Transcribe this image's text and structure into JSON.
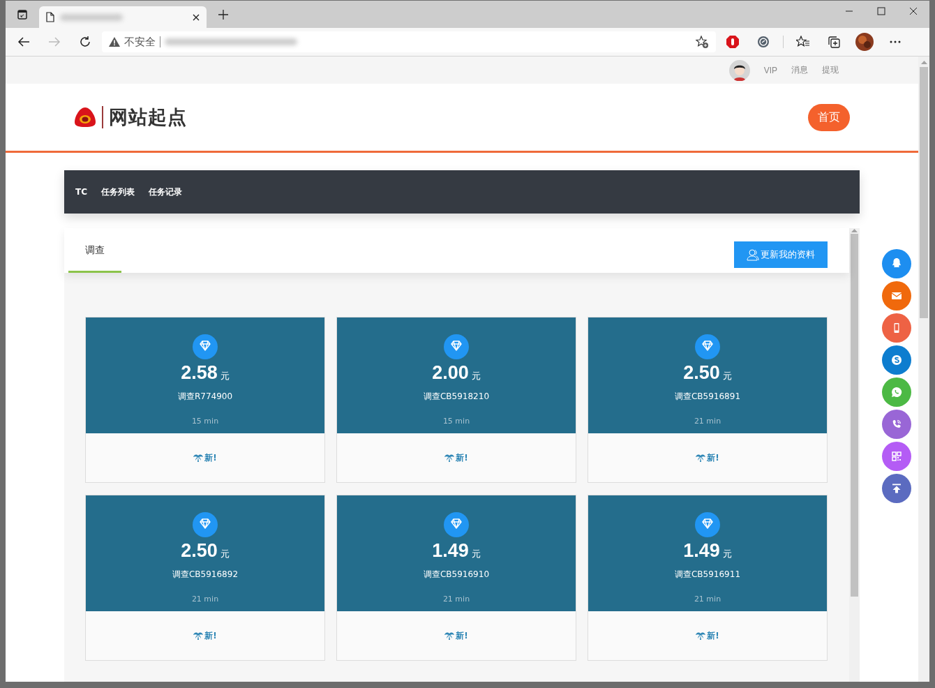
{
  "browser": {
    "security_label": "不安全"
  },
  "topbar": {
    "links": [
      "VIP",
      "消息",
      "提现"
    ]
  },
  "header": {
    "logo_text": "网站起点",
    "home_button": "首页"
  },
  "nav": {
    "items": [
      "TC",
      "任务列表",
      "任务记录"
    ]
  },
  "tabs": [
    {
      "label": "调查",
      "selected": true
    }
  ],
  "update_button": "更新我的资料",
  "tasks": [
    {
      "amount": "2.58",
      "unit": "元",
      "title": "调查R774900",
      "duration": "15 min",
      "badge": "新!"
    },
    {
      "amount": "2.00",
      "unit": "元",
      "title": "调查CB5918210",
      "duration": "15 min",
      "badge": "新!"
    },
    {
      "amount": "2.50",
      "unit": "元",
      "title": "调查CB5916891",
      "duration": "21 min",
      "badge": "新!"
    },
    {
      "amount": "2.50",
      "unit": "元",
      "title": "调查CB5916892",
      "duration": "21 min",
      "badge": "新!"
    },
    {
      "amount": "1.49",
      "unit": "元",
      "title": "调查CB5916910",
      "duration": "21 min",
      "badge": "新!"
    },
    {
      "amount": "1.49",
      "unit": "元",
      "title": "调查CB5916911",
      "duration": "21 min",
      "badge": "新!"
    }
  ],
  "side_buttons": [
    {
      "kind": "qq",
      "color": "#1d8ef0"
    },
    {
      "kind": "mail",
      "color": "#f0690c"
    },
    {
      "kind": "phone",
      "color": "#ee6244"
    },
    {
      "kind": "skype",
      "color": "#0d7dcf"
    },
    {
      "kind": "whatsapp",
      "color": "#4cb944"
    },
    {
      "kind": "viber",
      "color": "#9966d6"
    },
    {
      "kind": "qr",
      "color": "#b45cf5"
    },
    {
      "kind": "top",
      "color": "#5b6bc0"
    }
  ]
}
